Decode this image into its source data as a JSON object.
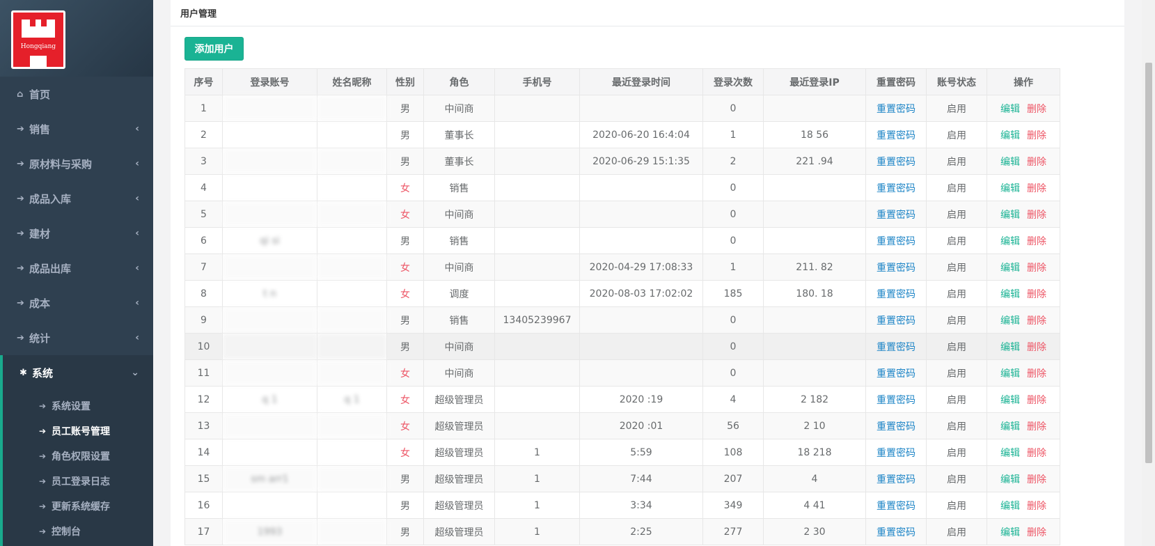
{
  "logo": {
    "text": "Hongqiang"
  },
  "nav": [
    {
      "icon": "home-icon",
      "glyph": "⌂",
      "label": "首页",
      "chevron": ""
    },
    {
      "icon": "arrow-right-icon",
      "glyph": "➔",
      "label": "销售",
      "chevron": "‹"
    },
    {
      "icon": "arrow-right-icon",
      "glyph": "➔",
      "label": "原材料与采购",
      "chevron": "‹"
    },
    {
      "icon": "arrow-right-icon",
      "glyph": "➔",
      "label": "成品入库",
      "chevron": "‹"
    },
    {
      "icon": "arrow-right-icon",
      "glyph": "➔",
      "label": "建材",
      "chevron": "‹"
    },
    {
      "icon": "arrow-right-icon",
      "glyph": "➔",
      "label": "成品出库",
      "chevron": "‹"
    },
    {
      "icon": "arrow-right-icon",
      "glyph": "➔",
      "label": "成本",
      "chevron": "‹"
    },
    {
      "icon": "arrow-right-icon",
      "glyph": "➔",
      "label": "统计",
      "chevron": "‹"
    }
  ],
  "system": {
    "icon": "gear-icon",
    "glyph": "✱",
    "label": "系统",
    "chevron": "⌄",
    "items": [
      "系统设置",
      "员工账号管理",
      "角色权限设置",
      "员工登录日志",
      "更新系统缓存",
      "控制台"
    ],
    "current_index": 1
  },
  "box_title": "用户管理",
  "add_button": "添加用户",
  "table": {
    "headers": [
      "序号",
      "登录账号",
      "姓名昵称",
      "性别",
      "角色",
      "手机号",
      "最近登录时间",
      "登录次数",
      "最近登录IP",
      "重置密码",
      "账号状态",
      "操作"
    ],
    "reset_label": "重置密码",
    "edit_label": "编辑",
    "delete_label": "删除",
    "rows": [
      {
        "no": "1",
        "account": "",
        "name": "",
        "gender": "男",
        "role": "中间商",
        "phone": "",
        "last_login": "",
        "count": "0",
        "ip": "",
        "status": "启用"
      },
      {
        "no": "2",
        "account": "",
        "name": "",
        "gender": "男",
        "role": "董事长",
        "phone": "",
        "last_login": "2020-06-20 16:4:04",
        "count": "1",
        "ip": "18 56",
        "status": "启用"
      },
      {
        "no": "3",
        "account": "",
        "name": "",
        "gender": "男",
        "role": "董事长",
        "phone": "",
        "last_login": "2020-06-29 15:1:35",
        "count": "2",
        "ip": "221 .94",
        "status": "启用"
      },
      {
        "no": "4",
        "account": "",
        "name": "",
        "gender": "女",
        "role": "销售",
        "phone": "",
        "last_login": "",
        "count": "0",
        "ip": "",
        "status": "启用"
      },
      {
        "no": "5",
        "account": "",
        "name": "",
        "gender": "女",
        "role": "中间商",
        "phone": "",
        "last_login": "",
        "count": "0",
        "ip": "",
        "status": "启用"
      },
      {
        "no": "6",
        "account": "qi si",
        "name": "",
        "gender": "男",
        "role": "销售",
        "phone": "",
        "last_login": "",
        "count": "0",
        "ip": "",
        "status": "启用"
      },
      {
        "no": "7",
        "account": "",
        "name": "",
        "gender": "女",
        "role": "中间商",
        "phone": "",
        "last_login": "2020-04-29 17:08:33",
        "count": "1",
        "ip": "211. 82",
        "status": "启用"
      },
      {
        "no": "8",
        "account": "t n",
        "name": "",
        "gender": "女",
        "role": "调度",
        "phone": "",
        "last_login": "2020-08-03 17:02:02",
        "count": "185",
        "ip": "180. 18",
        "status": "启用"
      },
      {
        "no": "9",
        "account": "",
        "name": "",
        "gender": "男",
        "role": "销售",
        "phone": "13405239967",
        "last_login": "",
        "count": "0",
        "ip": "",
        "status": "启用"
      },
      {
        "no": "10",
        "account": "",
        "name": "",
        "gender": "男",
        "role": "中间商",
        "phone": "",
        "last_login": "",
        "count": "0",
        "ip": "",
        "status": "启用"
      },
      {
        "no": "11",
        "account": "",
        "name": "",
        "gender": "女",
        "role": "中间商",
        "phone": "",
        "last_login": "",
        "count": "0",
        "ip": "",
        "status": "启用"
      },
      {
        "no": "12",
        "account": "q 1",
        "name": "q 1",
        "gender": "女",
        "role": "超级管理员",
        "phone": "",
        "last_login": "2020 :19",
        "count": "4",
        "ip": "2 182",
        "status": "启用"
      },
      {
        "no": "13",
        "account": "",
        "name": "",
        "gender": "女",
        "role": "超级管理员",
        "phone": "",
        "last_login": "2020 :01",
        "count": "56",
        "ip": "2 10",
        "status": "启用"
      },
      {
        "no": "14",
        "account": "",
        "name": "",
        "gender": "女",
        "role": "超级管理员",
        "phone": "1",
        "last_login": "5:59",
        "count": "108",
        "ip": "18 218",
        "status": "启用"
      },
      {
        "no": "15",
        "account": "sm arr1",
        "name": "",
        "gender": "男",
        "role": "超级管理员",
        "phone": "1",
        "last_login": "7:44",
        "count": "207",
        "ip": "4",
        "status": "启用"
      },
      {
        "no": "16",
        "account": "",
        "name": "",
        "gender": "男",
        "role": "超级管理员",
        "phone": "1",
        "last_login": "3:34",
        "count": "349",
        "ip": "4 41",
        "status": "启用"
      },
      {
        "no": "17",
        "account": "1993",
        "name": "",
        "gender": "男",
        "role": "超级管理员",
        "phone": "1",
        "last_login": "2:25",
        "count": "277",
        "ip": "2 30",
        "status": "启用"
      }
    ]
  },
  "colors": {
    "sidebar_bg": "#2f4050",
    "accent": "#1ab394",
    "link_blue": "#1c84c6",
    "danger": "#ed5565"
  }
}
